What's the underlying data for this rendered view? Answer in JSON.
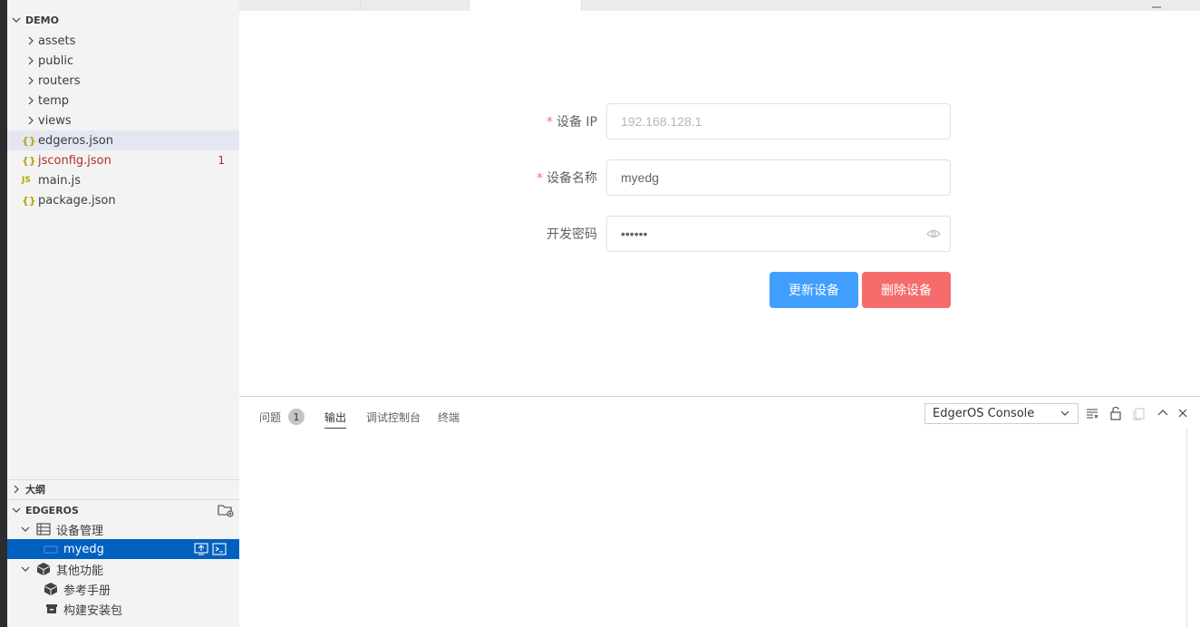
{
  "explorer": {
    "root_label": "DEMO",
    "items": [
      {
        "type": "folder",
        "label": "assets"
      },
      {
        "type": "folder",
        "label": "public"
      },
      {
        "type": "folder",
        "label": "routers"
      },
      {
        "type": "folder",
        "label": "temp"
      },
      {
        "type": "folder",
        "label": "views"
      },
      {
        "type": "json",
        "label": "edgeros.json",
        "selected": true
      },
      {
        "type": "json",
        "label": "jsconfig.json",
        "problems": "1"
      },
      {
        "type": "js",
        "label": "main.js"
      },
      {
        "type": "json",
        "label": "package.json"
      }
    ],
    "json_icon": "{}",
    "js_icon": "JS"
  },
  "outline": {
    "label": "大纲"
  },
  "edgeros": {
    "label": "EDGEROS",
    "device_mgmt": "设备管理",
    "device_name": "myedg",
    "other_features": "其他功能",
    "reference_manual": "参考手册",
    "build_package": "构建安装包"
  },
  "form": {
    "ip_label": "设备 IP",
    "ip_placeholder": "192.168.128.1",
    "name_label": "设备名称",
    "name_value": "myedg",
    "password_label": "开发密码",
    "password_value": "••••••",
    "required_mark": "*",
    "update_button": "更新设备",
    "delete_button": "删除设备"
  },
  "panel": {
    "tabs": [
      {
        "label": "问题",
        "badge": "1"
      },
      {
        "label": "输出",
        "active": true
      },
      {
        "label": "调试控制台"
      },
      {
        "label": "终端"
      }
    ],
    "console_select": "EdgerOS Console"
  },
  "colors": {
    "primary": "#409eff",
    "danger": "#f56c6c",
    "selection": "#0060c0"
  }
}
